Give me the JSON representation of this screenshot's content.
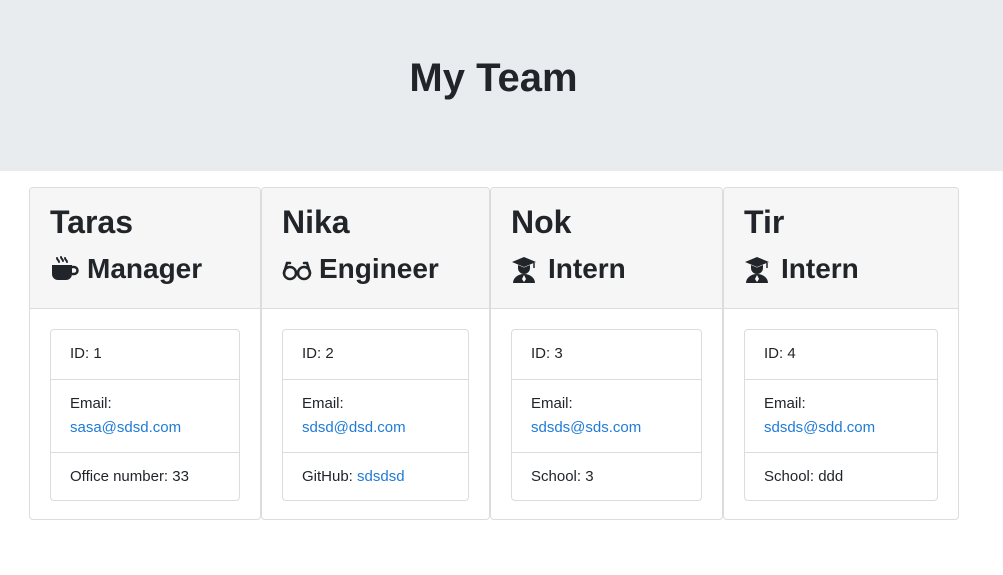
{
  "header": {
    "title": "My Team"
  },
  "cards": [
    {
      "name": "Taras",
      "role": "Manager",
      "role_icon": "coffee-cup-icon",
      "id_text": "ID: 1",
      "email_label": "Email:",
      "email": "sasa@sdsd.com",
      "extra_label": "Office number: 33",
      "extra_link": ""
    },
    {
      "name": "Nika",
      "role": "Engineer",
      "role_icon": "glasses-icon",
      "id_text": "ID: 2",
      "email_label": "Email:",
      "email": "sdsd@dsd.com",
      "extra_label": "GitHub: ",
      "extra_link": "sdsdsd"
    },
    {
      "name": "Nok",
      "role": "Intern",
      "role_icon": "graduate-icon",
      "id_text": "ID: 3",
      "email_label": "Email:",
      "email": "sdsds@sds.com",
      "extra_label": "School: 3",
      "extra_link": ""
    },
    {
      "name": "Tir",
      "role": "Intern",
      "role_icon": "graduate-icon",
      "id_text": "ID: 4",
      "email_label": "Email:",
      "email": "sdsds@sdd.com",
      "extra_label": "School: ddd",
      "extra_link": ""
    }
  ],
  "colors": {
    "header_bg": "#e9ecef",
    "card_header_bg": "#f6f6f6",
    "link": "#1f7bd6",
    "text": "#212529"
  }
}
